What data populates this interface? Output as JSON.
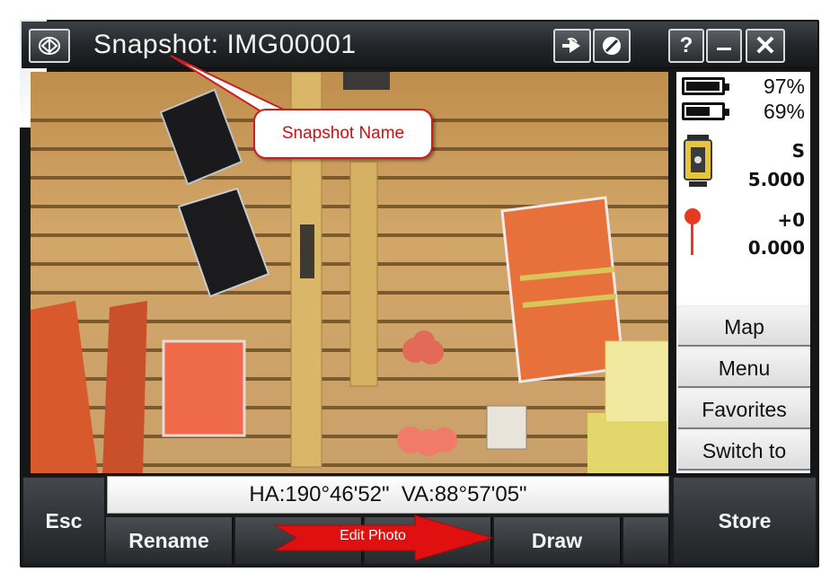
{
  "window": {
    "title": "Snapshot: IMG00001",
    "help_label": "?",
    "minimize_label": "—",
    "close_label": "✕"
  },
  "status": {
    "battery1_percent": "97%",
    "battery2_percent": "69%",
    "battery1_level": 0.97,
    "battery2_level": 0.69,
    "instrument_mode": "S",
    "instrument_value": "5.000",
    "prism_offset": "+0",
    "prism_height": "0.000"
  },
  "side_menu": {
    "items": [
      {
        "label": "Map"
      },
      {
        "label": "Menu"
      },
      {
        "label": "Favorites"
      },
      {
        "label": "Switch to"
      }
    ]
  },
  "readout": {
    "hava": "HA:190°46'52\"  VA:88°57'05\""
  },
  "buttons": {
    "esc": "Esc",
    "store": "Store",
    "rename": "Rename",
    "draw": "Draw"
  },
  "annotations": {
    "snapshot_name": "Snapshot Name",
    "edit_photo": "Edit Photo"
  },
  "colors": {
    "callout_red": "#cc1010",
    "arrow_red": "#e01010",
    "titlebar": "#222427",
    "wall": "#c99a57"
  },
  "icons": {
    "app": "trimble-logo-icon",
    "export": "arrow-right-icon",
    "disable": "slash-circle-icon",
    "instrument": "total-station-icon",
    "prism": "prism-pole-icon"
  }
}
